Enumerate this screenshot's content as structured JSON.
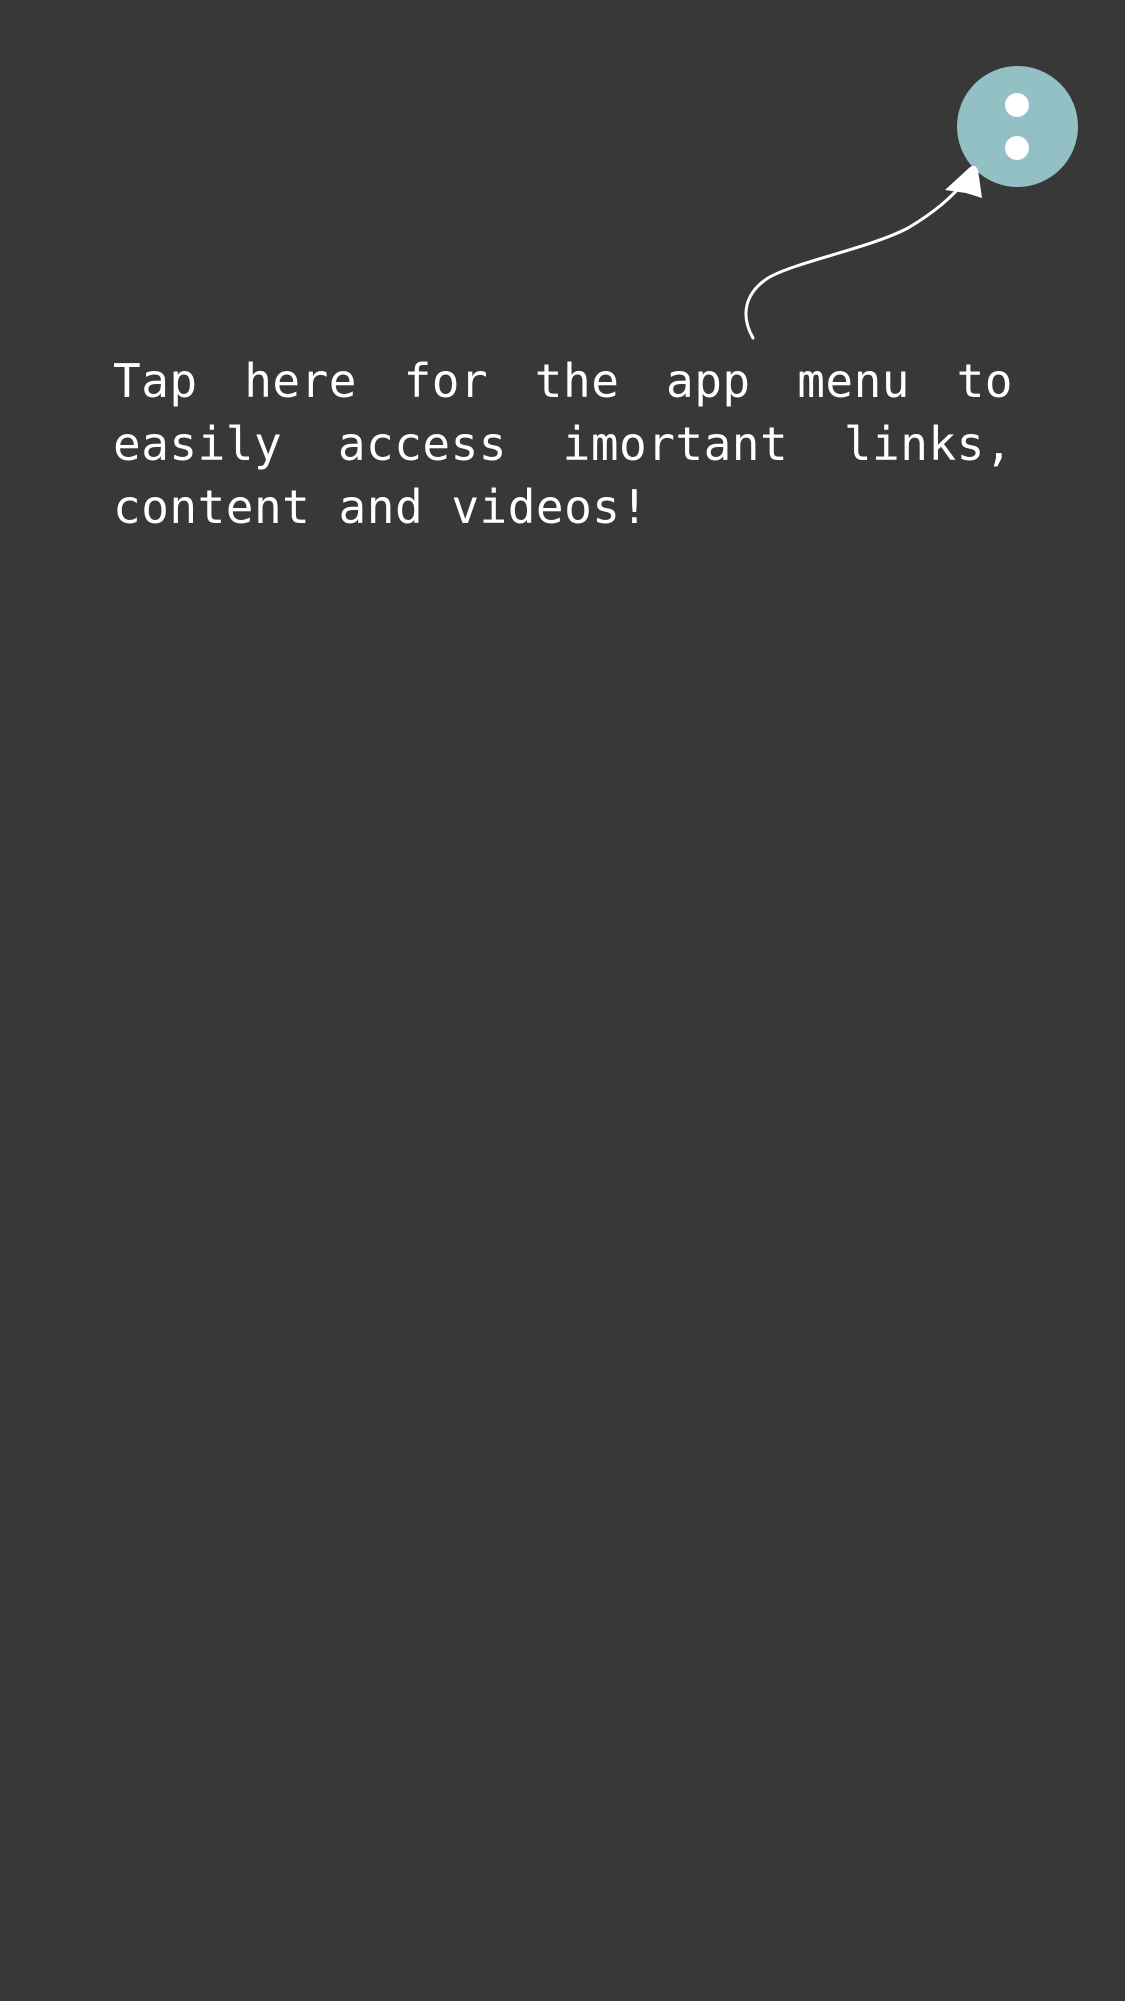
{
  "onboarding": {
    "hint_text": "Tap here for the app menu to easily access imortant links, content and videos!"
  },
  "menu_button": {
    "icon": "vertical-dots-icon",
    "color": "#92c0c4"
  },
  "arrow": {
    "icon": "curved-arrow-icon",
    "color": "#ffffff"
  },
  "theme": {
    "background": "#383838",
    "text_color": "#ffffff"
  }
}
